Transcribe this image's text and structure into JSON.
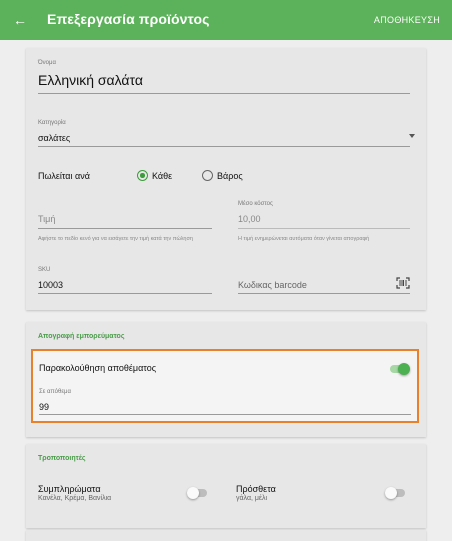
{
  "appbar": {
    "back_icon": "←",
    "title": "Επεξεργασία προϊόντος",
    "save_label": "ΑΠΟΘΗΚΕΥΣΗ"
  },
  "product": {
    "name_label": "Όνομα",
    "name_value": "Ελληνική σαλάτα",
    "category_label": "Κατηγορία",
    "category_value": "σαλάτες",
    "sold_by_label": "Πωλείται ανά",
    "sold_by_options": [
      "Κάθε",
      "Βάρος"
    ],
    "sold_by_selected": "Κάθε",
    "avg_cost_label": "Μέσο κόστος",
    "price_placeholder": "Τιμή",
    "avg_cost_value": "10,00",
    "price_hint": "Αφήστε το πεδίο κενό για να εισάγετε την τιμή κατά την πώληση",
    "cost_hint": "Η τιμή ενημερώνεται αυτόματα όταν γίνεται απογραφή",
    "sku_label": "SKU",
    "sku_value": "10003",
    "barcode_placeholder": "Κωδικας barcode"
  },
  "inventory": {
    "section_title": "Απογραφή εμπορεύματος",
    "track_label": "Παρακολούθηση αποθέματος",
    "track_enabled": true,
    "stock_label": "Σε απόθεμα",
    "stock_value": "99"
  },
  "modifiers": {
    "section_title": "Τροποποιητές",
    "items": [
      {
        "name": "Συμπληρώματα",
        "options": "Κανέλα, Κρέμα, Βανίλια",
        "enabled": false
      },
      {
        "name": "Πρόσθετα",
        "options": "γάλα, μέλι",
        "enabled": false
      }
    ]
  },
  "colors": {
    "primary": "#5cb25a",
    "highlight": "#e8802c",
    "section": "#4a9b4a"
  }
}
